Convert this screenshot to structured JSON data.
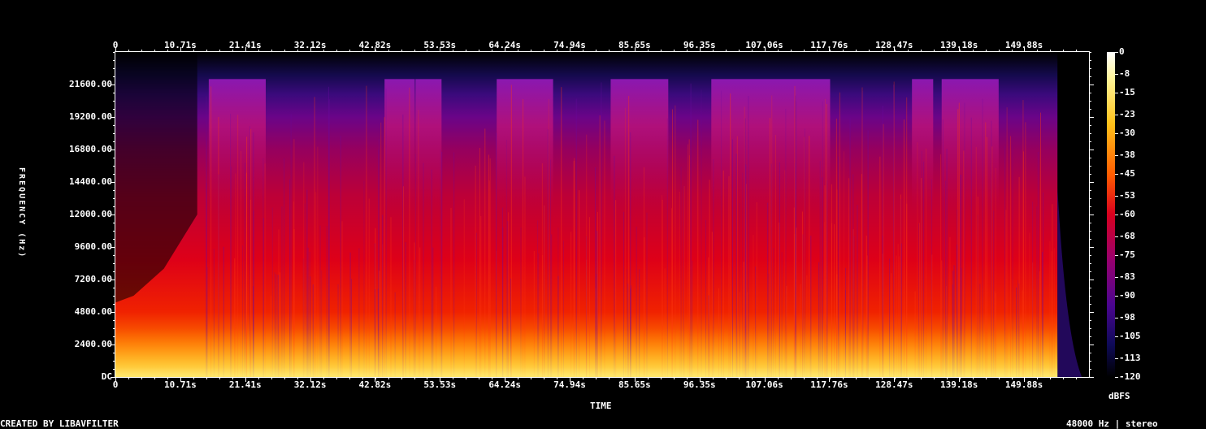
{
  "chart_data": {
    "type": "heatmap",
    "xlabel": "TIME",
    "ylabel": "FREQUENCY (Hz)",
    "colorbar_label": "dBFS",
    "footer_left": "CREATED BY LIBAVFILTER",
    "footer_right": "48000 Hz | stereo",
    "x_range": [
      0,
      160.6
    ],
    "x_ticks": [
      0,
      10.71,
      21.41,
      32.12,
      42.82,
      53.53,
      64.24,
      74.94,
      85.65,
      96.35,
      107.06,
      117.76,
      128.47,
      139.18,
      149.88
    ],
    "x_tick_labels": [
      "0",
      "10.71s",
      "21.41s",
      "32.12s",
      "42.82s",
      "53.53s",
      "64.24s",
      "74.94s",
      "85.65s",
      "96.35s",
      "107.06s",
      "117.76s",
      "128.47s",
      "139.18s",
      "149.88s"
    ],
    "y_range": [
      0,
      24000
    ],
    "y_ticks": [
      0,
      2400,
      4800,
      7200,
      9600,
      12000,
      14400,
      16800,
      19200,
      21600
    ],
    "y_tick_labels": [
      "DC",
      "2400.00",
      "4800.00",
      "7200.00",
      "9600.00",
      "12000.00",
      "14400.00",
      "16800.00",
      "19200.00",
      "21600.00"
    ],
    "colorbar_range": [
      -120,
      0
    ],
    "colorbar_ticks": [
      0,
      -8,
      -15,
      -23,
      -30,
      -38,
      -45,
      -53,
      -60,
      -68,
      -75,
      -83,
      -90,
      -98,
      -105,
      -113,
      -120
    ],
    "colorbar_tick_labels": [
      "0",
      "-8",
      "-15",
      "-23",
      "-30",
      "-38",
      "-45",
      "-53",
      "-60",
      "-68",
      "-75",
      "-83",
      "-90",
      "-98",
      "-105",
      "-113",
      "-120"
    ],
    "audio_end_time": 155.4,
    "high_band_segments_s": [
      [
        15.4,
        24.8
      ],
      [
        44.4,
        49.4
      ],
      [
        49.5,
        53.8
      ],
      [
        62.9,
        72.2
      ],
      [
        81.7,
        91.2
      ],
      [
        98.3,
        117.9
      ],
      [
        131.4,
        134.9
      ],
      [
        136.3,
        145.7
      ]
    ],
    "high_band_top_hz": 22000
  }
}
